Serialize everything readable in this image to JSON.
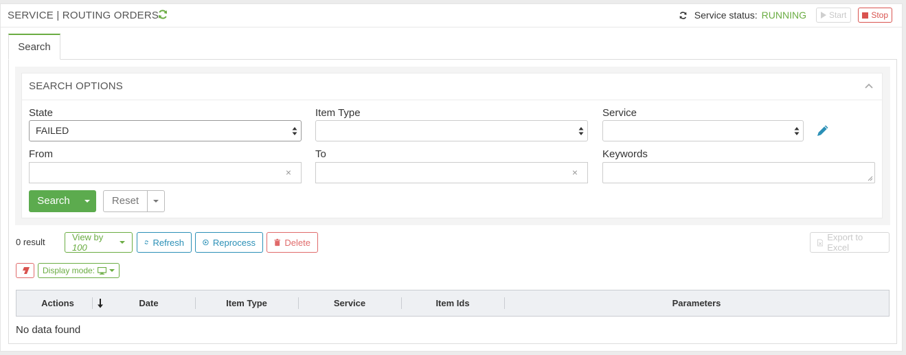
{
  "header": {
    "title": "SERVICE | ROUTING ORDERS",
    "status_label": "Service status:",
    "status_value": "RUNNING",
    "start_label": "Start",
    "stop_label": "Stop"
  },
  "tabs": [
    {
      "label": "Search"
    }
  ],
  "search_options": {
    "title": "SEARCH OPTIONS",
    "state": {
      "label": "State",
      "value": "FAILED"
    },
    "item_type": {
      "label": "Item Type",
      "value": ""
    },
    "service": {
      "label": "Service",
      "value": ""
    },
    "from": {
      "label": "From",
      "value": ""
    },
    "to": {
      "label": "To",
      "value": ""
    },
    "keywords": {
      "label": "Keywords",
      "value": ""
    },
    "clear_glyph": "×",
    "search_button": "Search",
    "reset_button": "Reset"
  },
  "toolbar": {
    "result_count": "0 result",
    "view_by_label": "View by",
    "view_by_value": "100",
    "refresh_label": "Refresh",
    "reprocess_label": "Reprocess",
    "delete_label": "Delete",
    "export_label": "Export to Excel",
    "display_mode_label": "Display mode:"
  },
  "table": {
    "columns": [
      "Actions",
      "Date",
      "Item Type",
      "Service",
      "Item Ids",
      "Parameters"
    ],
    "empty_message": "No data found"
  },
  "colors": {
    "accent_green": "#6aac42",
    "button_green": "#5cab4e",
    "blue": "#2a8fb6",
    "red": "#d9534f"
  },
  "icons": [
    "refresh-icon",
    "sync-icon",
    "play-icon",
    "stop-icon",
    "chevron-up-icon",
    "updown-icon",
    "pencil-icon",
    "caret-down-icon",
    "trash-icon",
    "eraser-icon",
    "monitor-icon",
    "sort-down-icon",
    "file-excel-icon"
  ]
}
